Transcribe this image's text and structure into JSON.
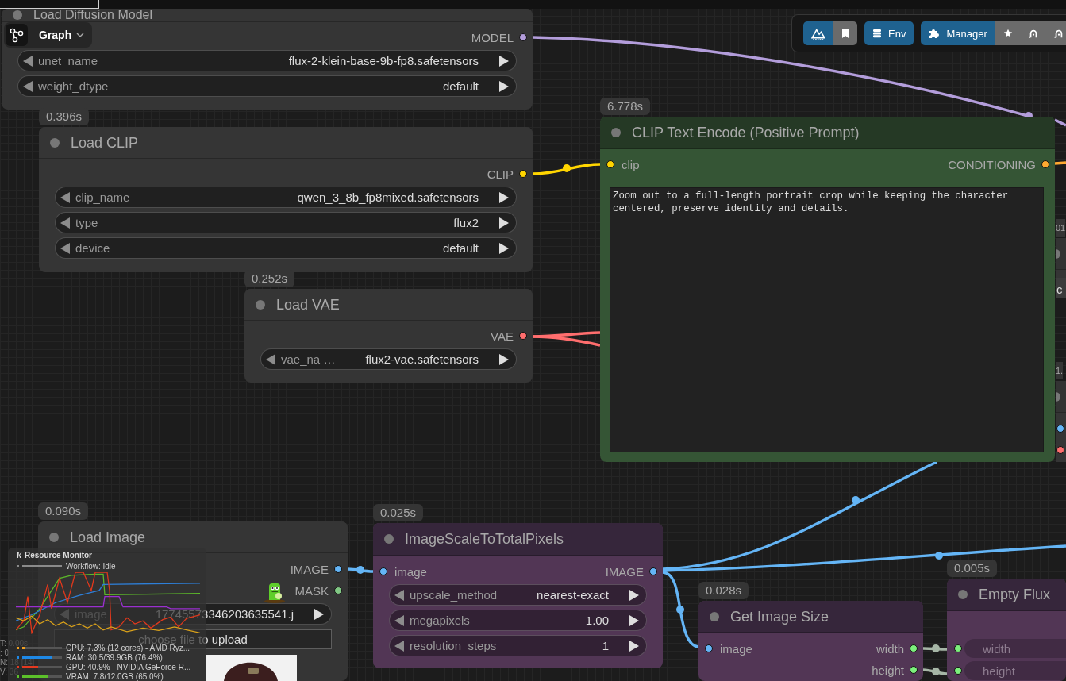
{
  "graph_menu": {
    "label": "Graph"
  },
  "toolbar": {
    "groups": [
      {
        "buttons": [
          {
            "kind": "primary"
          },
          {
            "kind": "secondary"
          }
        ]
      },
      {
        "buttons": [
          {
            "kind": "primary",
            "label": "Env"
          }
        ]
      },
      {
        "buttons": [
          {
            "kind": "primary",
            "label": "Manager"
          },
          {
            "kind": "secondary"
          },
          {
            "kind": "secondary"
          },
          {
            "kind": "secondary"
          }
        ]
      }
    ]
  },
  "nodes": [
    {
      "kind": "plain",
      "title": "Load Diffusion Model",
      "outputs": [
        {
          "label": "MODEL",
          "color": "#b39ddb"
        }
      ],
      "widgets": [
        {
          "label": "unet_name",
          "value": "flux-2-klein-base-9b-fp8.safetensors"
        },
        {
          "label": "weight_dtype",
          "value": "default"
        }
      ]
    },
    {
      "kind": "plain",
      "time": "0.396s",
      "title": "Load CLIP",
      "outputs": [
        {
          "label": "CLIP",
          "color": "#ffd500"
        }
      ],
      "widgets": [
        {
          "label": "clip_name",
          "value": "qwen_3_8b_fp8mixed.safetensors"
        },
        {
          "label": "type",
          "value": "flux2"
        },
        {
          "label": "device",
          "value": "default"
        }
      ]
    },
    {
      "kind": "conditioning",
      "time": "6.778s",
      "title": "CLIP Text Encode (Positive Prompt)",
      "inputs": [
        {
          "kind": "slot",
          "label": "clip",
          "color": "#ffd500"
        }
      ],
      "outputs": [
        {
          "label": "CONDITIONING",
          "color": "#ffa931"
        }
      ],
      "prompt": "Zoom out to a full-length portrait crop while keeping the character centered, preserve identity and details."
    },
    {
      "kind": "clipped",
      "time": "01",
      "widgets": [
        {
          "value": "c"
        }
      ]
    },
    {
      "kind": "plain",
      "time": "0.252s",
      "title": "Load VAE",
      "outputs": [
        {
          "label": "VAE",
          "color": "#ff6e6e"
        }
      ],
      "widgets": [
        {
          "label": "vae_na …",
          "value": "flux2-vae.safetensors"
        }
      ]
    },
    {
      "kind": "clipped",
      "time": "1.",
      "inputs": [
        {
          "kind": "slot",
          "color": "#64b5f6"
        },
        {
          "kind": "slot",
          "color": "#ff6e6e"
        }
      ]
    },
    {
      "kind": "plain",
      "time": "0.090s",
      "title": "Load Image",
      "outputs": [
        {
          "label": "IMAGE",
          "color": "#64b5f6"
        },
        {
          "label": "MASK",
          "color": "#81c784"
        }
      ],
      "widgets": [
        {
          "label": "image",
          "value": "17745573346203635541.j"
        }
      ],
      "upload_button": "choose file to upload",
      "preview": true
    },
    {
      "kind": "image",
      "time": "0.025s",
      "title": "ImageScaleToTotalPixels",
      "inputs": [
        {
          "kind": "slot",
          "label": "image",
          "color": "#64b5f6"
        }
      ],
      "outputs": [
        {
          "label": "IMAGE",
          "color": "#64b5f6"
        }
      ],
      "widgets": [
        {
          "label": "upscale_method",
          "value": "nearest-exact"
        },
        {
          "label": "megapixels",
          "value": "1.00"
        },
        {
          "label": "resolution_steps",
          "value": "1"
        }
      ]
    },
    {
      "kind": "image",
      "time": "0.028s",
      "title": "Get Image Size",
      "inputs": [
        {
          "kind": "slot",
          "label": "image",
          "color": "#64b5f6"
        }
      ],
      "outputs": [
        {
          "label": "width",
          "color": "#7cf07c"
        },
        {
          "label": "height",
          "color": "#7cf07c"
        }
      ]
    },
    {
      "kind": "image",
      "time": "0.005s",
      "title": "Empty Flux",
      "inputs": [
        {
          "kind": "widget",
          "label": "width",
          "color": "#7cf07c"
        },
        {
          "kind": "widget",
          "label": "height",
          "color": "#7cf07c"
        }
      ]
    }
  ],
  "links": [
    {
      "color": "#b39ddb"
    },
    {
      "color": "#ffd500"
    },
    {
      "color": "#ff6e6e"
    },
    {
      "color": "#ff6e6e"
    },
    {
      "color": "#ffa931"
    },
    {
      "color": "#64b5f6"
    },
    {
      "color": "#64b5f6"
    },
    {
      "color": "#64b5f6"
    },
    {
      "color": "#64b5f6"
    },
    {
      "color": "#a6b6a6"
    },
    {
      "color": "#a6b6a6"
    }
  ],
  "edge_stats": [
    "T: 0.00s",
    ": 0",
    "N: 18 [14]",
    "V: 36"
  ],
  "resource_monitor": {
    "title": "Resource Monitor",
    "workflow": "Workflow: Idle",
    "meters": [
      {
        "label": "CPU: 7.3% (12 cores) - AMD Ryz...",
        "level": 0.073,
        "color": "#f0a020"
      },
      {
        "label": "RAM: 30.5/39.9GB (76.4%)",
        "level": 0.764,
        "color": "#1e88e5"
      },
      {
        "label": "GPU: 40.9% - NVIDIA GeForce R...",
        "level": 0.409,
        "color": "#e53920"
      },
      {
        "label": "VRAM: 7.8/12.0GB (65.0%)",
        "level": 0.65,
        "color": "#5cc02a"
      }
    ]
  }
}
